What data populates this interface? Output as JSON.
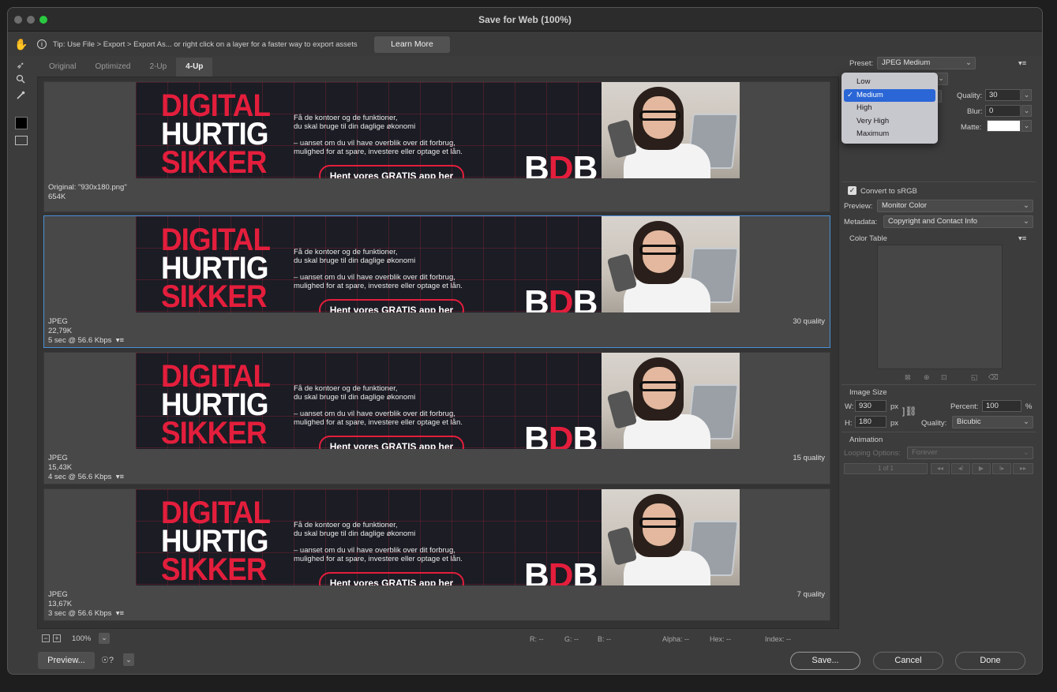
{
  "window": {
    "title": "Save for Web (100%)"
  },
  "tip": {
    "text": "Tip: Use File > Export > Export As... or right click on a layer for a faster way to export assets",
    "learn_more_label": "Learn More"
  },
  "tabs": [
    {
      "label": "Original"
    },
    {
      "label": "Optimized"
    },
    {
      "label": "2-Up"
    },
    {
      "label": "4-Up"
    }
  ],
  "banner": {
    "line1": "DIGITAL",
    "line2": "HURTIG",
    "line3": "SIKKER",
    "copy1a": "Få de kontoer og de funktioner,",
    "copy1b": "du skal bruge til din daglige økonomi",
    "copy2a": "– uanset om du vil have overblik over dit forbrug,",
    "copy2b": "mulighed for at spare, investere eller optage et lån.",
    "button": "Hent vores GRATIS app her",
    "logo_b1": "B",
    "logo_r": "D",
    "logo_b2": "B"
  },
  "panes": [
    {
      "format": "Original: \"930x180.png\"",
      "size": "654K",
      "speed": "",
      "quality": ""
    },
    {
      "format": "JPEG",
      "size": "22,79K",
      "speed": "5 sec @ 56.6 Kbps",
      "quality": "30 quality"
    },
    {
      "format": "JPEG",
      "size": "15,43K",
      "speed": "4 sec @ 56.6 Kbps",
      "quality": "15 quality"
    },
    {
      "format": "JPEG",
      "size": "13,67K",
      "speed": "3 sec @ 56.6 Kbps",
      "quality": "7 quality"
    }
  ],
  "statusbar": {
    "zoom": "100%",
    "r": "R: --",
    "g": "G: --",
    "b": "B: --",
    "alpha": "Alpha: --",
    "hex": "Hex: --",
    "index": "Index: --"
  },
  "buttons": {
    "preview": "Preview...",
    "save": "Save...",
    "cancel": "Cancel",
    "done": "Done"
  },
  "settings": {
    "preset_label": "Preset:",
    "preset_value": "JPEG Medium",
    "quality_label": "Quality:",
    "quality_value": "30",
    "blur_label": "Blur:",
    "blur_value": "0",
    "matte_label": "Matte:",
    "convert_srgb": "Convert to sRGB",
    "preview_label": "Preview:",
    "preview_value": "Monitor Color",
    "metadata_label": "Metadata:",
    "metadata_value": "Copyright and Contact Info",
    "color_table": "Color Table",
    "image_size": "Image Size",
    "w_label": "W:",
    "w_value": "930",
    "h_label": "H:",
    "h_value": "180",
    "px": "px",
    "percent_label": "Percent:",
    "percent_value": "100",
    "percent_unit": "%",
    "resample_label": "Quality:",
    "resample_value": "Bicubic",
    "animation": "Animation",
    "looping_label": "Looping Options:",
    "looping_value": "Forever",
    "frame_counter": "1 of 1"
  },
  "quality_dropdown": {
    "options": [
      "Low",
      "Medium",
      "High",
      "Very High",
      "Maximum"
    ],
    "selected": "Medium",
    "check": "✓"
  },
  "colors": {
    "accent_red": "#e31e3c",
    "selection_blue": "#4a90d9",
    "menu_highlight": "#2a66d6"
  }
}
